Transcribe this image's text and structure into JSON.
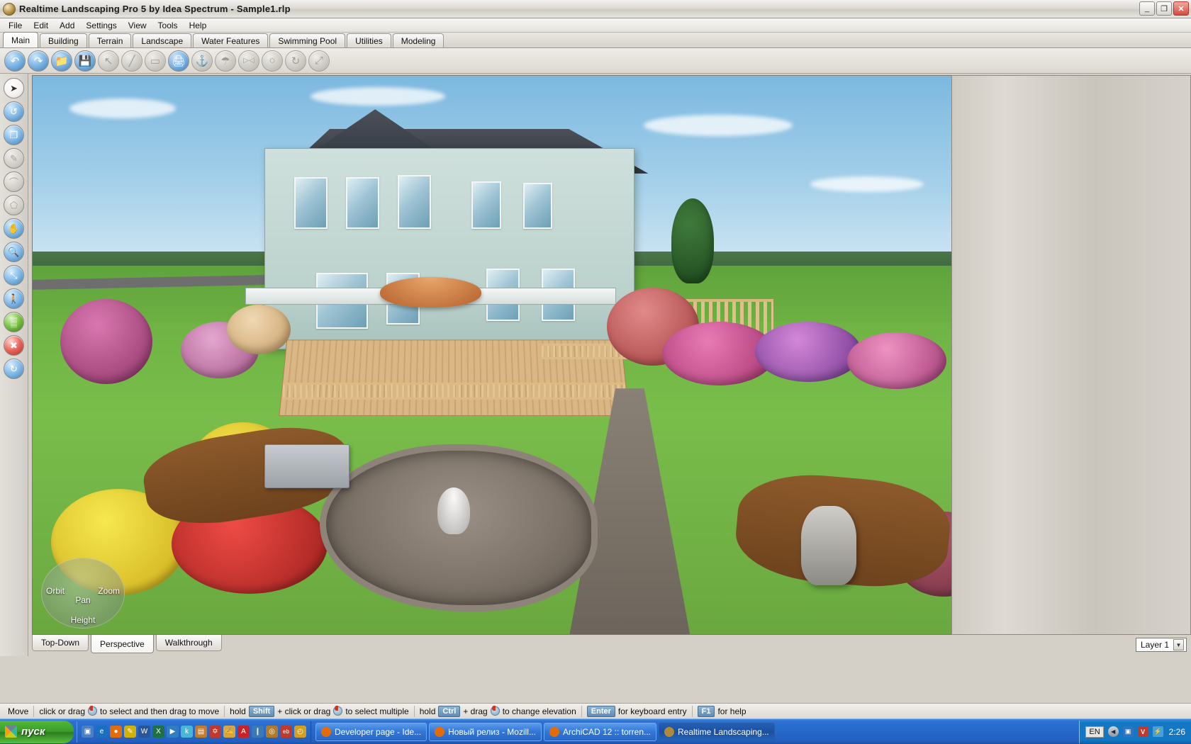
{
  "window": {
    "title": "Realtime Landscaping Pro 5 by Idea Spectrum - Sample1.rlp",
    "app_icon": "app-globe-icon",
    "minimize_label": "_",
    "restore_label": "❐",
    "close_label": "✕"
  },
  "menu": {
    "items": [
      {
        "label": "File"
      },
      {
        "label": "Edit"
      },
      {
        "label": "Add"
      },
      {
        "label": "Settings"
      },
      {
        "label": "View"
      },
      {
        "label": "Tools"
      },
      {
        "label": "Help"
      }
    ]
  },
  "tabs": {
    "active": "Main",
    "items": [
      {
        "label": "Main"
      },
      {
        "label": "Building"
      },
      {
        "label": "Terrain"
      },
      {
        "label": "Landscape"
      },
      {
        "label": "Water Features"
      },
      {
        "label": "Swimming Pool"
      },
      {
        "label": "Utilities"
      },
      {
        "label": "Modeling"
      }
    ]
  },
  "toolbar": {
    "buttons": [
      {
        "name": "undo-icon",
        "glyph": "↶",
        "enabled": true
      },
      {
        "name": "redo-icon",
        "glyph": "↷",
        "enabled": true
      },
      {
        "name": "open-folder-icon",
        "glyph": "📁",
        "enabled": true
      },
      {
        "name": "save-icon",
        "glyph": "💾",
        "enabled": true
      },
      {
        "name": "select-arrow-icon",
        "glyph": "↖",
        "enabled": false
      },
      {
        "name": "measure-icon",
        "glyph": "╱",
        "enabled": false
      },
      {
        "name": "wall-icon",
        "glyph": "▭",
        "enabled": false
      },
      {
        "name": "print-icon",
        "glyph": "🖨",
        "enabled": true
      },
      {
        "name": "camera-icon",
        "glyph": "⚓",
        "enabled": false
      },
      {
        "name": "sprinkler-icon",
        "glyph": "☂",
        "enabled": false
      },
      {
        "name": "mirror-icon",
        "glyph": "▷◁",
        "enabled": false
      },
      {
        "name": "shape-icon",
        "glyph": "○",
        "enabled": false
      },
      {
        "name": "rotate-icon",
        "glyph": "↻",
        "enabled": false
      },
      {
        "name": "scale-icon",
        "glyph": "⤢",
        "enabled": false
      }
    ]
  },
  "left_toolbar": {
    "buttons": [
      {
        "name": "pointer-tool-icon",
        "glyph": "➤",
        "style": "white"
      },
      {
        "name": "rotate-tool-icon",
        "glyph": "↺",
        "style": "blue"
      },
      {
        "name": "copy-tool-icon",
        "glyph": "❐",
        "style": "blue"
      },
      {
        "name": "pencil-tool-icon",
        "glyph": "✎",
        "style": "disabled"
      },
      {
        "name": "curve-tool-icon",
        "glyph": "⌒",
        "style": "disabled"
      },
      {
        "name": "polygon-tool-icon",
        "glyph": "⬠",
        "style": "disabled"
      },
      {
        "name": "pan-hand-icon",
        "glyph": "✋",
        "style": "blue"
      },
      {
        "name": "zoom-tool-icon",
        "glyph": "🔍",
        "style": "blue"
      },
      {
        "name": "zoom-extents-icon",
        "glyph": "⤡",
        "style": "blue"
      },
      {
        "name": "walkthrough-icon",
        "glyph": "🚶",
        "style": "blue"
      },
      {
        "name": "terrain-grid-icon",
        "glyph": "▒",
        "style": "green"
      },
      {
        "name": "delete-tool-icon",
        "glyph": "✖",
        "style": "red"
      },
      {
        "name": "refresh-tool-icon",
        "glyph": "↻",
        "style": "blue"
      }
    ]
  },
  "viewport": {
    "nav_widget": {
      "orbit": "Orbit",
      "zoom": "Zoom",
      "pan": "Pan",
      "height": "Height"
    },
    "scene_description": "3D rendered landscape design: two-story light-green clapboard house with dark shingle roof, wooden deck with patio umbrella, table and chairs, flower beds with pink, yellow, red and purple blooms, a rock-lined pond with fountain, gravel paths, stone garden sculpture and wooden pergola on a green lawn under a blue sky."
  },
  "view_tabs": {
    "active": "Perspective",
    "items": [
      {
        "label": "Top-Down"
      },
      {
        "label": "Perspective"
      },
      {
        "label": "Walkthrough"
      }
    ]
  },
  "layer_selector": {
    "value": "Layer 1",
    "arrow": "▼"
  },
  "status_bar": {
    "mode": "Move",
    "segments": [
      {
        "prefix": "click or drag",
        "key": "",
        "mouse": true,
        "suffix": "to select and then drag to move"
      },
      {
        "prefix": "hold",
        "key": "Shift",
        "mouse": true,
        "mid": "+ click or drag",
        "suffix": "to select multiple"
      },
      {
        "prefix": "hold",
        "key": "Ctrl",
        "mouse": true,
        "mid": "+ drag",
        "suffix": "to change elevation"
      },
      {
        "prefix": "",
        "key": "Enter",
        "mouse": false,
        "suffix": "for keyboard entry"
      },
      {
        "prefix": "",
        "key": "F1",
        "mouse": false,
        "suffix": "for help"
      }
    ]
  },
  "taskbar": {
    "start_label": "пуск",
    "quick_launch": [
      {
        "name": "desktop-icon",
        "glyph": "▣",
        "color": "#4a7fc1"
      },
      {
        "name": "ie-icon",
        "glyph": "e",
        "color": "#1b6fc0"
      },
      {
        "name": "firefox-icon",
        "glyph": "●",
        "color": "#e36c0a"
      },
      {
        "name": "paint-icon",
        "glyph": "✎",
        "color": "#d4b106"
      },
      {
        "name": "word-icon",
        "glyph": "W",
        "color": "#2a5699"
      },
      {
        "name": "excel-icon",
        "glyph": "X",
        "color": "#1e7145"
      },
      {
        "name": "media-player-icon",
        "glyph": "▶",
        "color": "#2f7ec0"
      },
      {
        "name": "k-lite-icon",
        "glyph": "k",
        "color": "#49b6d6"
      },
      {
        "name": "photo-icon",
        "glyph": "▤",
        "color": "#c47b2a"
      },
      {
        "name": "maya-icon",
        "glyph": "✡",
        "color": "#c0392b"
      },
      {
        "name": "notes-icon",
        "glyph": "✍",
        "color": "#d9a441"
      },
      {
        "name": "acrobat-icon",
        "glyph": "A",
        "color": "#cc2127"
      },
      {
        "name": "device-icon",
        "glyph": "❙",
        "color": "#3c78b4"
      },
      {
        "name": "nero-icon",
        "glyph": "◎",
        "color": "#b07a2a"
      },
      {
        "name": "ebay-icon",
        "glyph": "eb",
        "color": "#c0392b"
      },
      {
        "name": "clock-icon",
        "glyph": "◴",
        "color": "#d6a01c"
      }
    ],
    "tasks": [
      {
        "label": "Developer page - Ide...",
        "icon": "firefox-icon",
        "icon_color": "#e36c0a",
        "active": false
      },
      {
        "label": "Новый релиз - Mozill...",
        "icon": "firefox-icon",
        "icon_color": "#e36c0a",
        "active": false
      },
      {
        "label": "ArchiCAD 12 :: torren...",
        "icon": "firefox-icon",
        "icon_color": "#e36c0a",
        "active": false
      },
      {
        "label": "Realtime Landscaping...",
        "icon": "app-globe-icon",
        "icon_color": "#b08a3c",
        "active": true
      }
    ],
    "tray": {
      "language": "EN",
      "show_hidden": "◀",
      "icons": [
        {
          "name": "network-icon",
          "glyph": "▣",
          "color": "#2f74c0"
        },
        {
          "name": "antivirus-icon",
          "glyph": "V",
          "color": "#c0392b"
        },
        {
          "name": "usb-icon",
          "glyph": "⚡",
          "color": "#49a0d6"
        }
      ],
      "clock": "2:26"
    }
  },
  "colors": {
    "accent_blue": "#2a6fd1",
    "start_green": "#3d9c2b",
    "title_gradient_light": "#f2f1ef",
    "panel_gray": "#d4d0c8",
    "lawn_green": "#79bd4b",
    "sky_blue": "#7cb8e0"
  }
}
